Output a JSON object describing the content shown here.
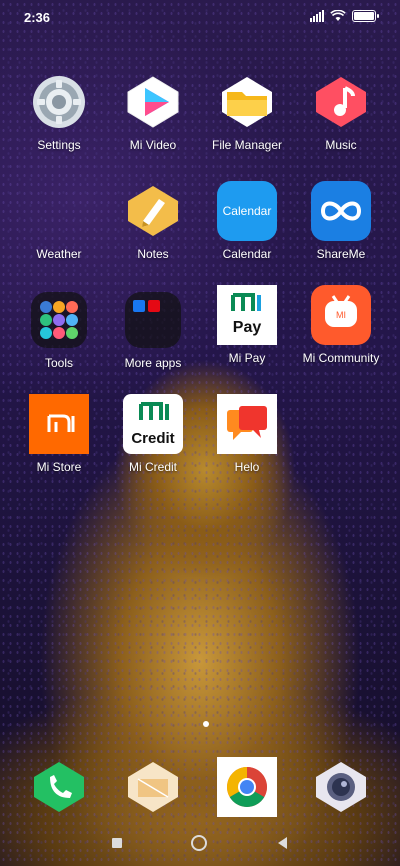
{
  "status": {
    "time": "2:36",
    "battery_level": 0.9
  },
  "grid": [
    {
      "label": "Settings"
    },
    {
      "label": "Mi Video"
    },
    {
      "label": "File Manager"
    },
    {
      "label": "Music"
    },
    {
      "label": "Weather"
    },
    {
      "label": "Notes"
    },
    {
      "label": "Calendar",
      "icon_text": "Calendar"
    },
    {
      "label": "ShareMe"
    },
    {
      "label": "Tools"
    },
    {
      "label": "More apps"
    },
    {
      "label": "Mi Pay",
      "icon_text": "Pay"
    },
    {
      "label": "Mi Community"
    },
    {
      "label": "Mi Store"
    },
    {
      "label": "Mi Credit",
      "icon_text": "Credit"
    },
    {
      "label": "Helo"
    }
  ],
  "dock": [
    {
      "name": "phone"
    },
    {
      "name": "messages"
    },
    {
      "name": "chrome"
    },
    {
      "name": "camera"
    }
  ],
  "colors": {
    "mi_orange": "#ff6900",
    "calendar_blue": "#1e9bf0",
    "shareme_blue": "#1b7fe3"
  }
}
